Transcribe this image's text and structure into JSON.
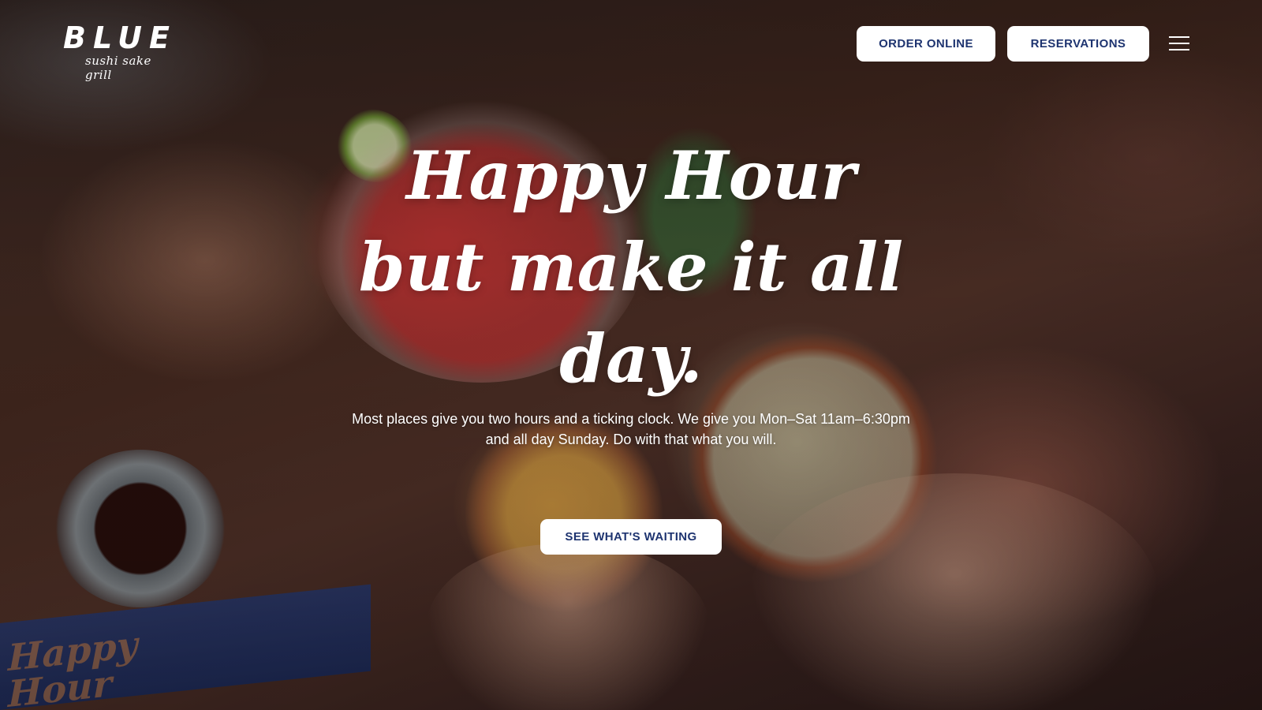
{
  "colors": {
    "button_bg": "#ffffff",
    "button_text": "#1e3470",
    "hero_text": "#ffffff"
  },
  "header": {
    "logo": {
      "word": "BLUE",
      "tagline": "sushi sake grill"
    },
    "order_online_label": "ORDER ONLINE",
    "reservations_label": "RESERVATIONS",
    "menu_icon": "hamburger-menu-icon"
  },
  "hero": {
    "title_lines": [
      "Happy Hour",
      "but make it all",
      "day."
    ],
    "subtitle": "Most places give you two hours and a ticking clock. We give you Mon–Sat 11am–6:30pm and all day Sunday. Do with that what you will.",
    "cta_label": "SEE WHAT'S WAITING",
    "background_image": "cocktails-cheers-photo"
  }
}
